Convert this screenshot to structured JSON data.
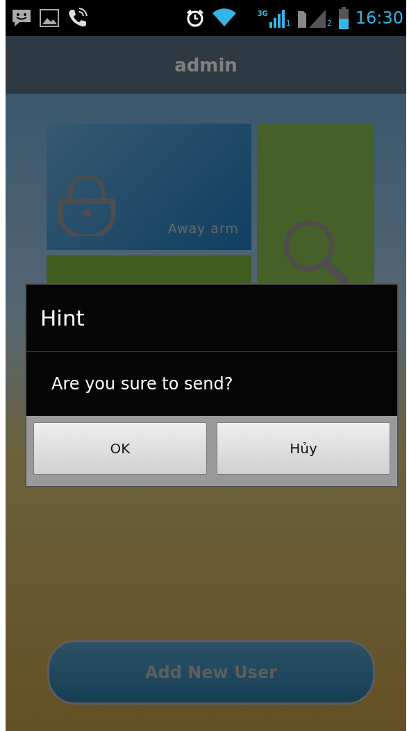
{
  "status_bar": {
    "network": "3G",
    "sim_1": "1",
    "sim_2": "2",
    "time": "16:30"
  },
  "header": {
    "title": "admin"
  },
  "tiles": [
    {
      "label": "Away arm",
      "kind": "lock"
    },
    {
      "kind": "plain"
    },
    {
      "kind": "search"
    }
  ],
  "add_user_button": {
    "label": "Add New User"
  },
  "dialog": {
    "title": "Hint",
    "message": "Are you sure to send?",
    "buttons": [
      "OK",
      "Hủy"
    ]
  }
}
